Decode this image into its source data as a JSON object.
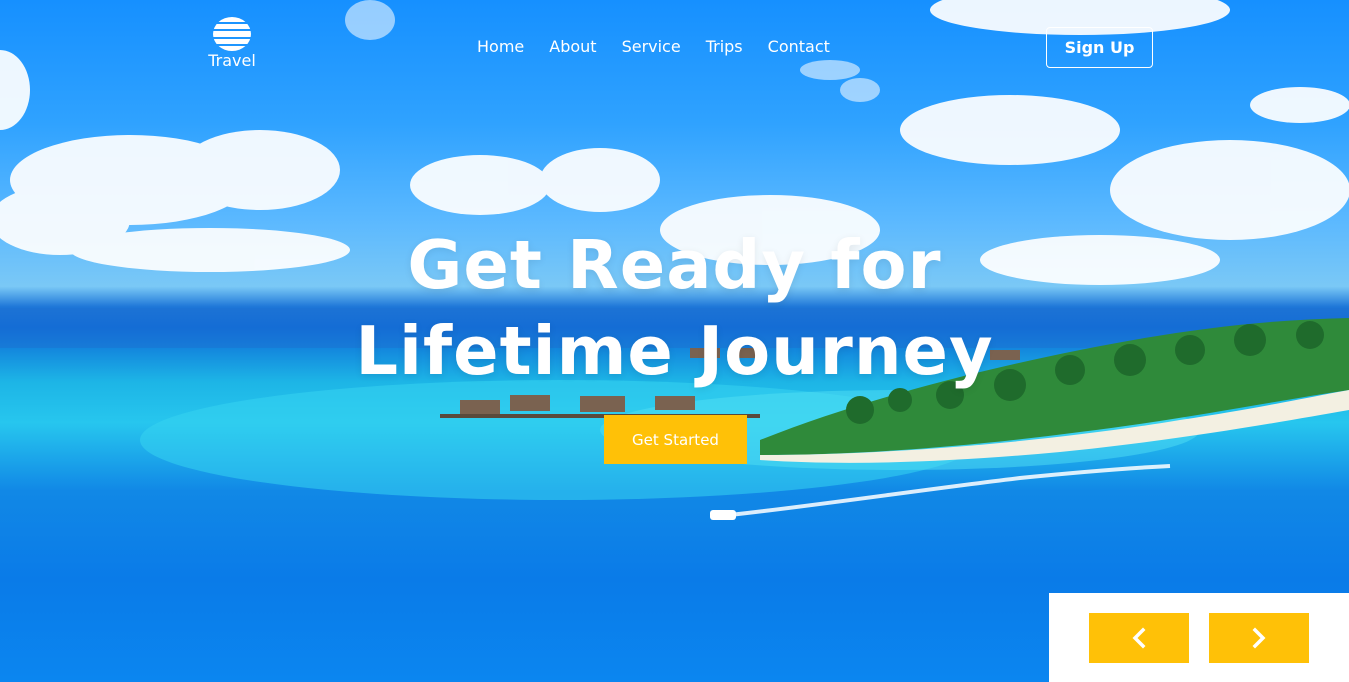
{
  "brand": {
    "name": "Travel",
    "logo_icon": "globe-icon"
  },
  "nav": {
    "items": [
      {
        "label": "Home"
      },
      {
        "label": "About"
      },
      {
        "label": "Service"
      },
      {
        "label": "Trips"
      },
      {
        "label": "Contact"
      }
    ]
  },
  "header": {
    "signup_label": "Sign Up"
  },
  "hero": {
    "title_line1": "Get Ready for",
    "title_line2": "Lifetime Journey",
    "cta_label": "Get Started"
  },
  "slider": {
    "prev_icon": "chevron-left-icon",
    "next_icon": "chevron-right-icon"
  },
  "colors": {
    "accent": "#ffc107",
    "sky": "#1690ff",
    "sea": "#0b86f0",
    "lagoon": "#27c6ee"
  }
}
